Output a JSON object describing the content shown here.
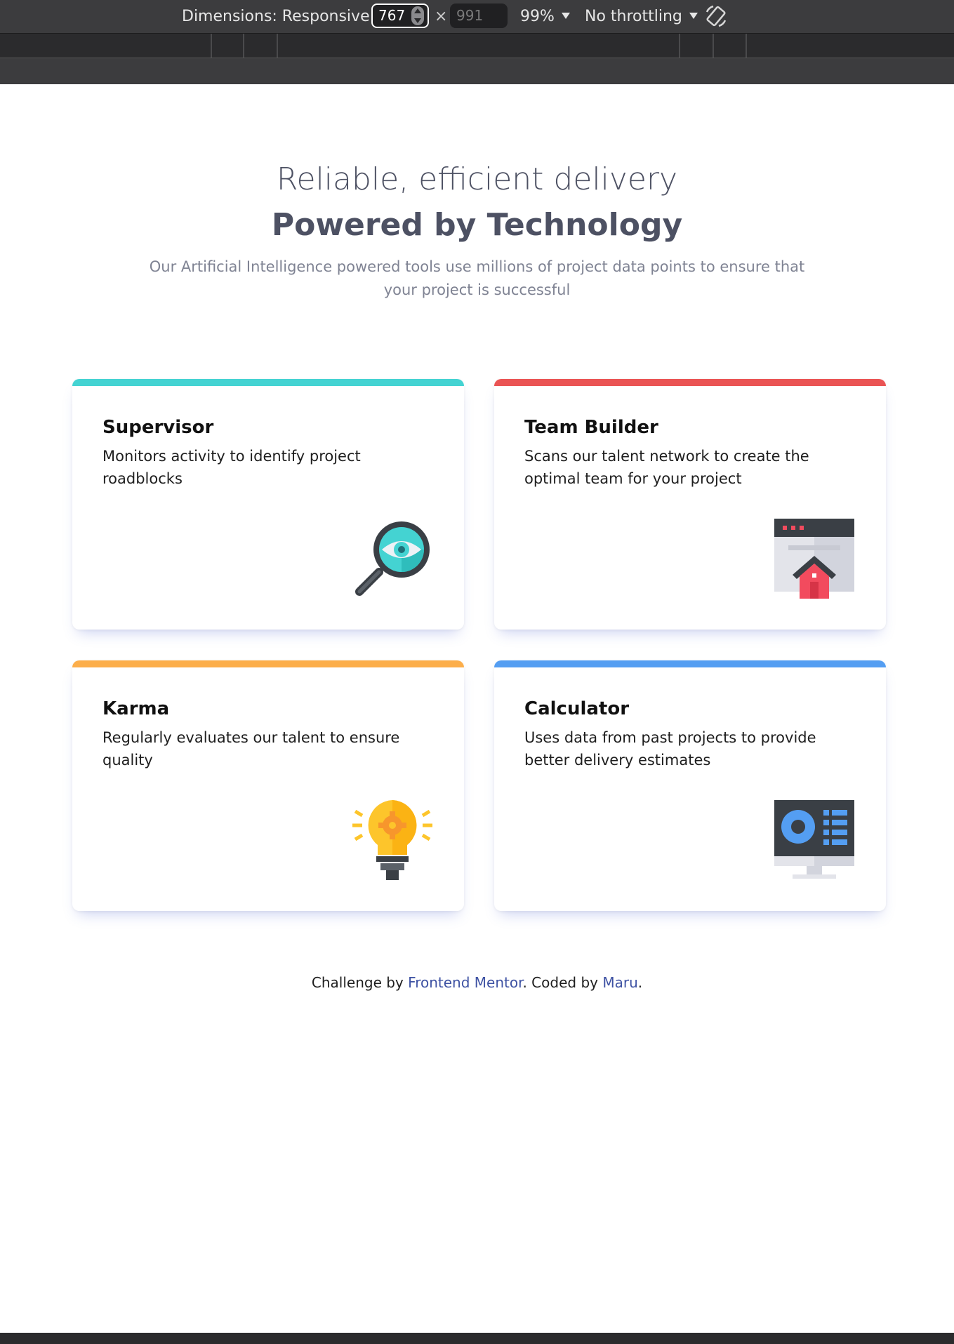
{
  "devtools": {
    "dimensions_label": "Dimensions: Responsive",
    "width_value": "767",
    "times_symbol": "×",
    "height_placeholder": "991",
    "zoom_label": "99%",
    "throttling_label": "No throttling"
  },
  "hero": {
    "subtitle": "Reliable, efficient delivery",
    "title": "Powered by Technology",
    "description": "Our Artificial Intelligence powered tools use millions of project data points to ensure that your project is successful"
  },
  "cards": [
    {
      "title": "Supervisor",
      "description": "Monitors activity to identify project roadblocks",
      "accent_color": "#44d3d2",
      "icon": "magnifier-eye-icon"
    },
    {
      "title": "Team Builder",
      "description": "Scans our talent network to create the optimal team for your project",
      "accent_color": "#ea5454",
      "icon": "browser-house-icon"
    },
    {
      "title": "Karma",
      "description": "Regularly evaluates our talent to ensure quality",
      "accent_color": "#fcae4a",
      "icon": "lightbulb-icon"
    },
    {
      "title": "Calculator",
      "description": "Uses data from past projects to provide better delivery estimates",
      "accent_color": "#549ef2",
      "icon": "monitor-chart-icon"
    }
  ],
  "footer": {
    "prefix": "Challenge by ",
    "link1": "Frontend Mentor",
    "middle": ". Coded by ",
    "link2": "Maru",
    "suffix": "."
  }
}
